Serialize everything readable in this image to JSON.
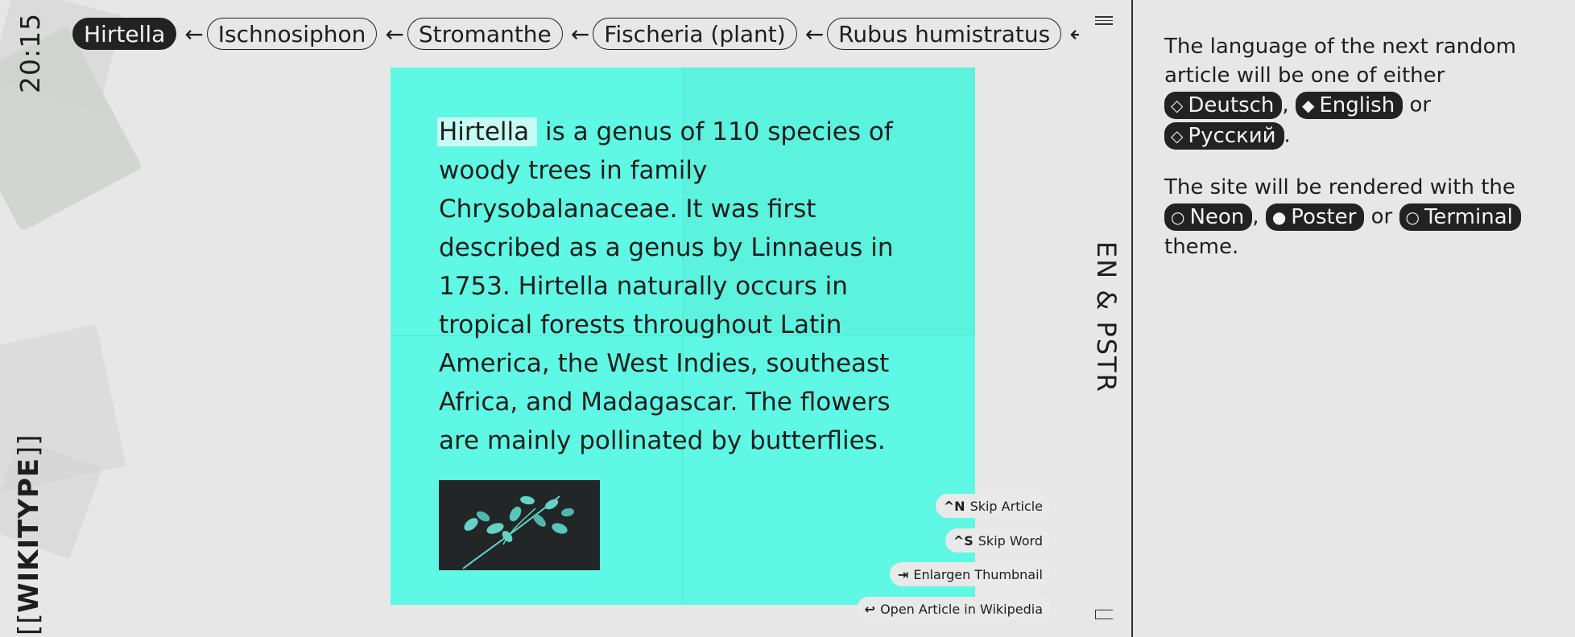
{
  "sidebar": {
    "clock": "20:15",
    "brand_open": "[[",
    "brand_name": "WIKITYPE",
    "brand_close": "]]"
  },
  "breadcrumbs": {
    "active": "Hirtella",
    "items": [
      "Ischnosiphon",
      "Stromanthe",
      "Fischeria (plant)",
      "Rubus humistratus"
    ],
    "arrow": "←"
  },
  "rail": {
    "theme_code": "EN & PSTR"
  },
  "article": {
    "highlight": "Hirtella",
    "text": " is a genus of 110 species of woody trees in family Chrysobalanaceae. It was first described as a genus by Linnaeus in 1753. Hirtella naturally occurs in tropical forests throughout Latin America, the West Indies, southeast Africa, and Madagascar. The flowers are mainly pollinated by butterflies.",
    "thumbnail_icon": "plant-thumbnail"
  },
  "shortcuts": [
    {
      "key": "^N",
      "label": "Skip Article"
    },
    {
      "key": "^S",
      "label": "Skip Word"
    },
    {
      "key": "⇥",
      "label": "Enlargen Thumbnail"
    },
    {
      "key": "↩",
      "label": "Open Article in Wikipedia"
    }
  ],
  "settings": {
    "language_intro": "The language of the next random article will be one of either",
    "languages": [
      {
        "symbol": "◇",
        "label": "Deutsch"
      },
      {
        "symbol": "◆",
        "label": "English"
      },
      {
        "symbol": "◇",
        "label": "Русский"
      }
    ],
    "comma": ",",
    "or": "or",
    "period": ".",
    "theme_intro": "The site will be rendered with the",
    "themes": [
      {
        "symbol": "○",
        "label": "Neon"
      },
      {
        "symbol": "●",
        "label": "Poster"
      },
      {
        "symbol": "○",
        "label": "Terminal"
      }
    ],
    "theme_outro": "theme."
  },
  "colors": {
    "card": "#5ef8e4",
    "background": "#e6e7e6",
    "ink": "#222222"
  }
}
